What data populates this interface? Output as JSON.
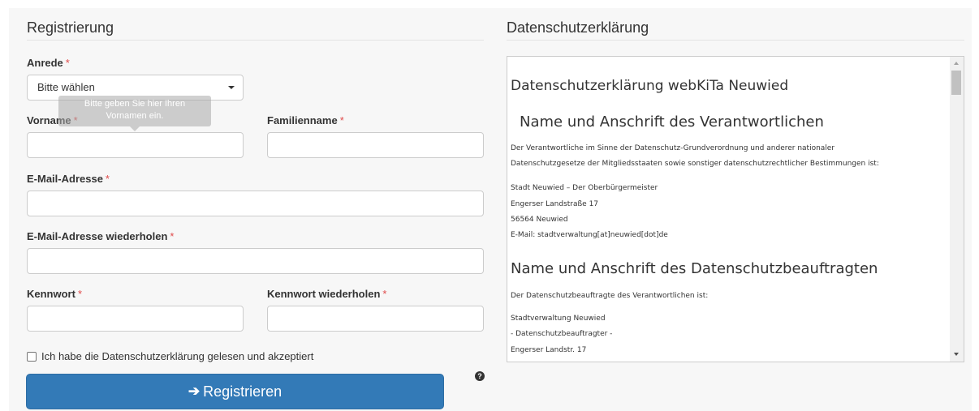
{
  "registration": {
    "title": "Registrierung",
    "required_mark": "*",
    "salutation": {
      "label": "Anrede",
      "value": "Bitte wählen"
    },
    "first_name": {
      "label": "Vorname",
      "tooltip_line1": "Bitte geben Sie hier Ihren",
      "tooltip_line2": "Vornamen ein."
    },
    "last_name": {
      "label": "Familienname"
    },
    "email": {
      "label": "E-Mail-Adresse"
    },
    "email_repeat": {
      "label": "E-Mail-Adresse wiederholen"
    },
    "password": {
      "label": "Kennwort"
    },
    "password_repeat": {
      "label": "Kennwort wiederholen"
    },
    "privacy_checkbox_label": "Ich habe die Datenschutzerklärung gelesen und akzeptiert",
    "submit_label": "Registrieren",
    "submit_icon": "sign-in-icon",
    "help_icon": "question-circle-icon"
  },
  "privacy": {
    "title": "Datenschutzerklärung",
    "doc_title": "Datenschutzerklärung webKiTa Neuwied",
    "section1_heading": "Name und Anschrift des Verantwortlichen",
    "section1_line1": "Der Verantwortliche im Sinne der Datenschutz-Grundverordnung und anderer nationaler",
    "section1_line2": "Datenschutzgesetze der Mitgliedsstaaten sowie sonstiger datenschutzrechtlicher Bestimmungen ist:",
    "address1_line1": "Stadt Neuwied – Der Oberbürgermeister",
    "address1_line2": "Engerser Landstraße 17",
    "address1_line3": "56564 Neuwied",
    "address1_line4": "E-Mail: stadtverwaltung[at]neuwied[dot]de",
    "section2_heading": "Name und Anschrift des Datenschutzbeauftragten",
    "section2_line1": "Der Datenschutzbeauftragte des Verantwortlichen ist:",
    "address2_line1": "Stadtverwaltung Neuwied",
    "address2_line2": "- Datenschutzbeauftragter -",
    "address2_line3": "Engerser Landstr. 17"
  },
  "colors": {
    "primary": "#337ab7",
    "required": "#e04b4b",
    "panel_bg": "#f7f7f7"
  }
}
